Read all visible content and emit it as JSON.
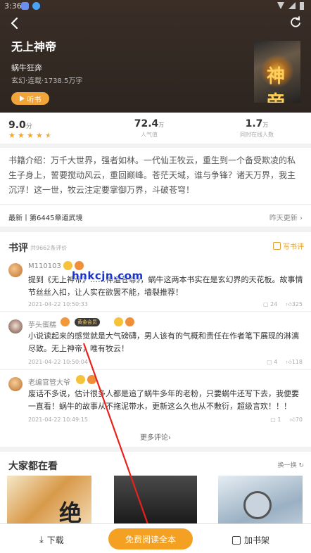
{
  "status": {
    "time": "3:36"
  },
  "book": {
    "title": "无上神帝",
    "author": "蜗牛狂奔",
    "meta": "玄幻·连载·1738.5万字",
    "listen_label": "听书",
    "cover_title": "神帝"
  },
  "stats": {
    "score": "9.0",
    "score_unit": "分",
    "rating_stars": 4.5,
    "popularity": "72.4",
    "popularity_unit": "万",
    "popularity_label": "人气值",
    "online": "1.7",
    "online_unit": "万",
    "online_label": "同时在线人数"
  },
  "intro": {
    "text": "书籍介绍：万千大世界，强者如林。一代仙王牧云，重生到一个备受欺凌的私生子身上，誓要搅动风云，重回巅峰。苍茫天域，谁与争锋？诸天万界，我主沉浮！这一世，牧云注定要掌御万界，斗破苍穹！",
    "latest": "最新丨第6445章道武境",
    "latest_time": "昨天更新"
  },
  "reviews": {
    "title": "书评",
    "count": "共9662条评价",
    "write_label": "写书评",
    "items": [
      {
        "name": "M110103",
        "text": "提到《无上神帝》……神道苍尊》，蜗牛这两本书实在是玄幻界的天花板。故事情节丝丝入扣，让人实在欲罢不能，墙裂推荐！",
        "date": "2021-04-22 10:50:33",
        "comments": "24",
        "likes": "325"
      },
      {
        "name": "芋头蛋糕",
        "vip": "黄金会员",
        "text": "小说读起来的感觉就是大气磅礴，男人该有的气概和责任在作者笔下展现的淋漓尽致。无上神帝，唯有牧云！",
        "date": "2021-04-22 10:50:04",
        "comments": "4",
        "likes": "118"
      },
      {
        "name": "老编官管大爷",
        "text": "废话不多说，估计很多人都是追了蜗牛多年的老粉，只要蜗牛还写下去，我便要一直看！蜗牛的故事从不拖泥带水，更新这么久也从不敷衍，超级言欢！！！",
        "date": "2021-04-22 10:49:15",
        "comments": "1",
        "likes": "70"
      }
    ],
    "more_label": "更多评论"
  },
  "recommend": {
    "title": "大家都在看",
    "swap_label": "换一换",
    "cover_text": "绝"
  },
  "watermark": "hnkcjn.com",
  "bottom": {
    "download": "下载",
    "read": "免费阅读全本",
    "shelf": "加书架"
  },
  "colors": {
    "accent": "#f4a123",
    "star": "#f5a623",
    "arrow": "#e8221b"
  }
}
